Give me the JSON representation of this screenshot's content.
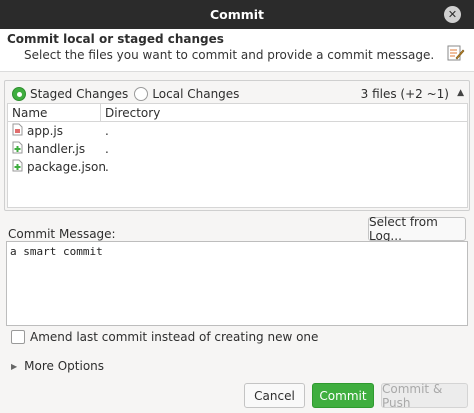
{
  "window": {
    "title": "Commit",
    "close_icon": "✕"
  },
  "header": {
    "title": "Commit local or staged changes",
    "description": "Select the files you want to commit and provide a commit message."
  },
  "changes": {
    "options": [
      {
        "label": "Staged Changes",
        "selected": true
      },
      {
        "label": "Local Changes",
        "selected": false
      }
    ],
    "files_count": "3 files (+2 ~1)",
    "columns": {
      "name": "Name",
      "directory": "Directory"
    },
    "files": [
      {
        "name": "app.js",
        "directory": ".",
        "status": "modified"
      },
      {
        "name": "handler.js",
        "directory": ".",
        "status": "added"
      },
      {
        "name": "package.json",
        "directory": ".",
        "status": "added"
      }
    ]
  },
  "message": {
    "label": "Commit Message:",
    "select_from_log": "Select from Log...",
    "value": "a smart commit"
  },
  "amend": {
    "label": "Amend last commit instead of creating new one",
    "checked": false
  },
  "more_options": {
    "label": "More Options"
  },
  "buttons": {
    "cancel": "Cancel",
    "commit": "Commit",
    "commit_push": "Commit & Push"
  },
  "colors": {
    "accent": "#3fae3f",
    "titlebar": "#2b2b2b"
  }
}
